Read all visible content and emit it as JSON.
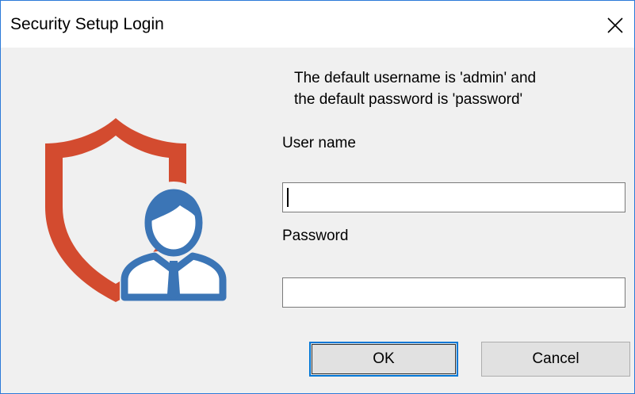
{
  "window": {
    "title": "Security Setup Login"
  },
  "info": {
    "line1": "The default username is 'admin' and",
    "line2": "the default password is 'password'"
  },
  "form": {
    "username_label": "User name",
    "username_value": "",
    "password_label": "Password",
    "password_value": ""
  },
  "buttons": {
    "ok": "OK",
    "cancel": "Cancel"
  },
  "icons": {
    "close": "close-icon",
    "illustration": "security-user-icon"
  },
  "colors": {
    "shield": "#d34b2f",
    "user": "#3b75b6",
    "focus_border": "#0078d7"
  }
}
